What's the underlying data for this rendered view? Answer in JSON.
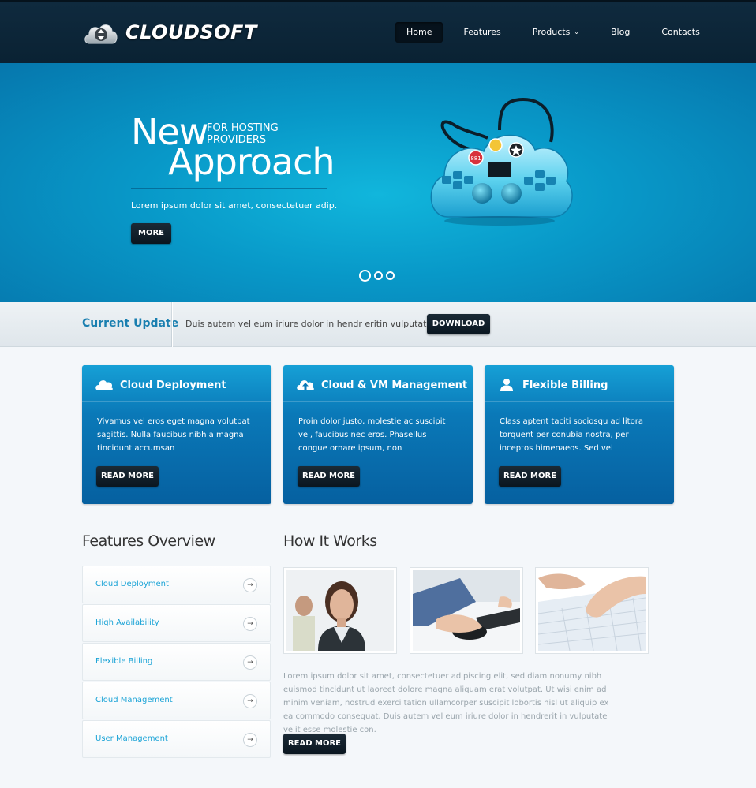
{
  "brand": {
    "name": "CLOUDSOFT"
  },
  "nav": [
    {
      "label": "Home",
      "active": true
    },
    {
      "label": "Features"
    },
    {
      "label": "Products",
      "caret": "⌄"
    },
    {
      "label": "Blog"
    },
    {
      "label": "Contacts"
    }
  ],
  "hero": {
    "word1": "New",
    "sub": "FOR HOSTING PROVIDERS",
    "word2": "Approach",
    "desc": "Lorem ipsum dolor sit amet, consectetuer adip.",
    "button": "MORE",
    "gamepad_label": "881"
  },
  "update": {
    "title": "Current Update",
    "text": "Duis autem vel eum iriure dolor in hendr eritin vulputate velit.",
    "button": "DOWNLOAD"
  },
  "features": [
    {
      "icon": "cloud-icon",
      "title": "Cloud Deployment",
      "text": "Vivamus vel eros eget magna volutpat sagittis. Nulla faucibus nibh a magna tincidunt accumsan",
      "button": "READ MORE"
    },
    {
      "icon": "cloud-upload-icon",
      "title": "Cloud & VM Management",
      "text": "Proin dolor justo, molestie ac suscipit vel, faucibus nec eros. Phasellus congue ornare ipsum, non",
      "button": "READ MORE"
    },
    {
      "icon": "user-icon",
      "title": "Flexible Billing",
      "text": "Class aptent taciti sociosqu ad litora torquent per conubia nostra, per inceptos himenaeos. Sed vel",
      "button": "READ MORE"
    }
  ],
  "overview": {
    "title": "Features Overview",
    "items": [
      "Cloud Deployment",
      "High Availability",
      "Flexible Billing",
      "Cloud Management",
      "User Management"
    ],
    "arrow": "→"
  },
  "how": {
    "title": "How It Works",
    "text": "Lorem ipsum dolor sit amet, consectetuer adipiscing elit, sed diam nonumy nibh euismod tincidunt ut laoreet dolore magna aliquam erat volutpat. Ut wisi enim ad minim veniam, nostrud exerci tation ullamcorper suscipit lobortis nisl ut aliquip ex ea commodo consequat. Duis autem vel eum iriure dolor in hendrerit in vulputate velit esse molestie con.",
    "button": "READ MORE"
  }
}
